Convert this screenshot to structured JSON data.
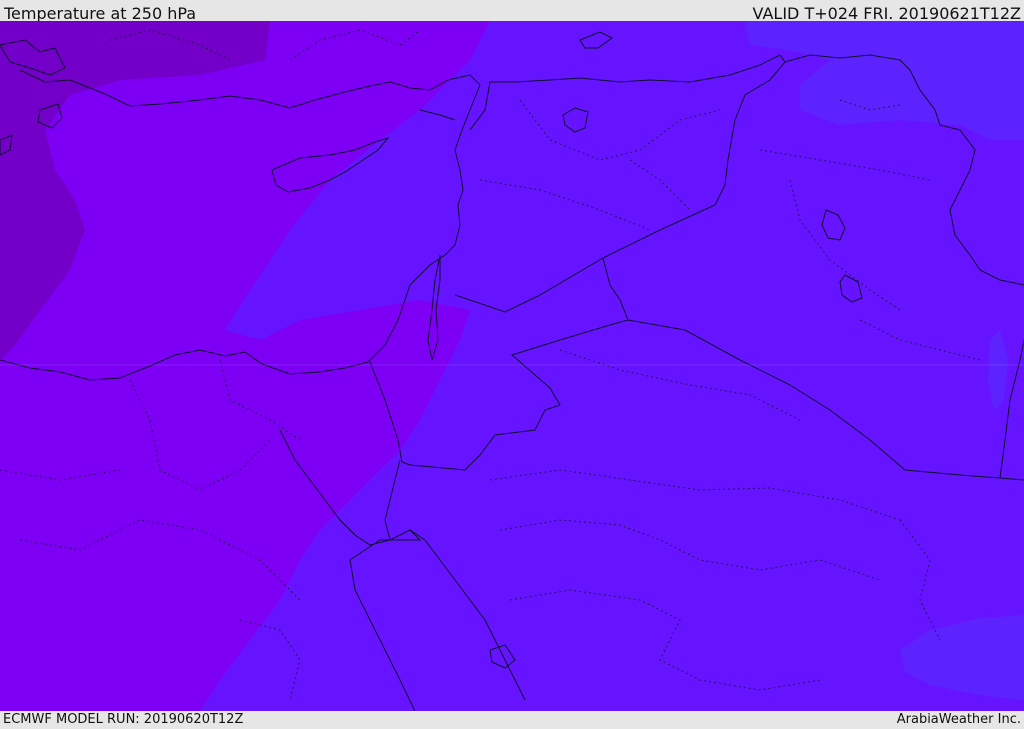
{
  "header": {
    "title": "Temperature at 250 hPa",
    "valid": "VALID T+024 FRI. 20190621T12Z"
  },
  "footer": {
    "model_run": "ECMWF MODEL RUN: 20190620T12Z",
    "credit": "ArabiaWeather Inc."
  },
  "map": {
    "field": "temperature",
    "colors": {
      "coldest": "#7300c8",
      "cold": "#7d00f5",
      "mid": "#6614ff",
      "warm": "#5c23ff",
      "warmest": "#5a2cff",
      "coast_line": "#101030",
      "border_line": "#101030"
    }
  }
}
